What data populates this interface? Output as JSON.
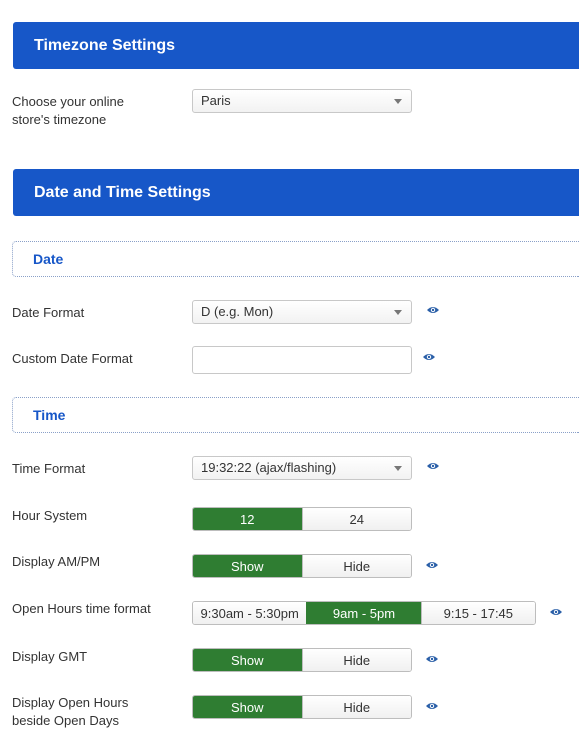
{
  "timezone_section": {
    "title": "Timezone Settings",
    "label": "Choose your online store's timezone",
    "value": "Paris"
  },
  "datetime_section": {
    "title": "Date and Time Settings",
    "date_subheader": "Date",
    "date_format_label": "Date Format",
    "date_format_value": "D (e.g. Mon)",
    "custom_date_label": "Custom Date Format",
    "custom_date_value": "",
    "time_subheader": "Time",
    "time_format_label": "Time Format",
    "time_format_value": "19:32:22 (ajax/flashing)",
    "hour_system_label": "Hour System",
    "hour_system_options": [
      "12",
      "24"
    ],
    "hour_system_selected": "12",
    "ampm_label": "Display AM/PM",
    "ampm_options": [
      "Show",
      "Hide"
    ],
    "ampm_selected": "Show",
    "open_hours_label": "Open Hours time format",
    "open_hours_options": [
      "9:30am - 5:30pm",
      "9am - 5pm",
      "9:15 - 17:45"
    ],
    "open_hours_selected": "9am - 5pm",
    "gmt_label": "Display GMT",
    "gmt_options": [
      "Show",
      "Hide"
    ],
    "gmt_selected": "Show",
    "open_beside_label": "Display Open Hours beside Open Days",
    "open_beside_options": [
      "Show",
      "Hide"
    ],
    "open_beside_selected": "Show"
  },
  "colors": {
    "header_blue": "#1757c8",
    "active_green": "#2f7d32",
    "eye_icon": "#2a5fa8"
  },
  "icons": {
    "preview": "eye-icon",
    "dropdown": "chevron-down-icon"
  }
}
